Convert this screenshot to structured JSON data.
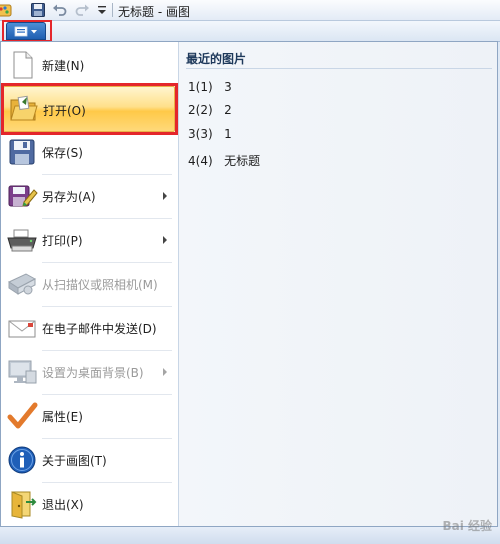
{
  "window": {
    "title": "无标题 - 画图"
  },
  "menu_items": [
    {
      "id": "new",
      "label": "新建(N)",
      "icon": "new-document-icon",
      "enabled": true,
      "has_submenu": false
    },
    {
      "id": "open",
      "label": "打开(O)",
      "icon": "open-folder-icon",
      "enabled": true,
      "has_submenu": false,
      "selected": true
    },
    {
      "id": "save",
      "label": "保存(S)",
      "icon": "save-disk-icon",
      "enabled": true,
      "has_submenu": false
    },
    {
      "id": "save-as",
      "label": "另存为(A)",
      "icon": "save-as-icon",
      "enabled": true,
      "has_submenu": true
    },
    {
      "id": "print",
      "label": "打印(P)",
      "icon": "printer-icon",
      "enabled": true,
      "has_submenu": true
    },
    {
      "id": "scanner",
      "label": "从扫描仪或照相机(M)",
      "icon": "scanner-camera-icon",
      "enabled": false,
      "has_submenu": false
    },
    {
      "id": "email",
      "label": "在电子邮件中发送(D)",
      "icon": "email-envelope-icon",
      "enabled": true,
      "has_submenu": false
    },
    {
      "id": "desktop-bg",
      "label": "设置为桌面背景(B)",
      "icon": "desktop-monitor-icon",
      "enabled": false,
      "has_submenu": true
    },
    {
      "id": "properties",
      "label": "属性(E)",
      "icon": "checkmark-icon",
      "enabled": true,
      "has_submenu": false
    },
    {
      "id": "about",
      "label": "关于画图(T)",
      "icon": "info-icon",
      "enabled": true,
      "has_submenu": false
    },
    {
      "id": "exit",
      "label": "退出(X)",
      "icon": "exit-door-icon",
      "enabled": true,
      "has_submenu": false
    }
  ],
  "recent": {
    "title": "最近的图片",
    "items": [
      {
        "index": "1(1)",
        "name": "3"
      },
      {
        "index": "2(2)",
        "name": "2"
      },
      {
        "index": "3(3)",
        "name": "1"
      },
      {
        "index": "4(4)",
        "name": "无标题"
      }
    ]
  },
  "watermark": "Bai 经验",
  "colors": {
    "highlight_red": "#e4262b",
    "selected_orange": "#ffc948",
    "app_button_blue": "#2a6cc0"
  }
}
